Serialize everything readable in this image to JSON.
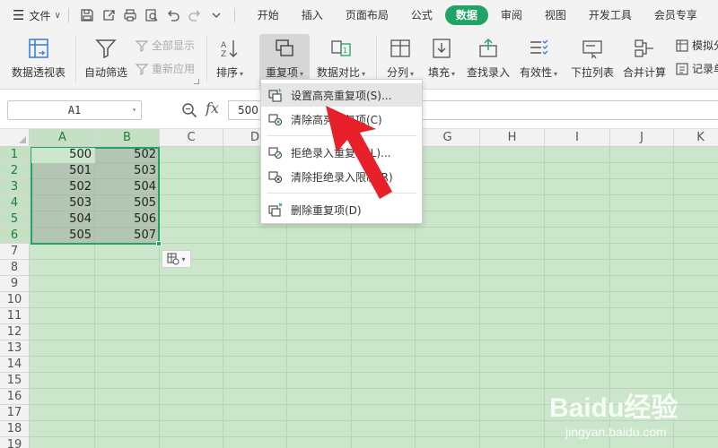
{
  "menubar": {
    "file_label": "文件",
    "tabs": [
      {
        "label": "开始",
        "active": false
      },
      {
        "label": "插入",
        "active": false
      },
      {
        "label": "页面布局",
        "active": false
      },
      {
        "label": "公式",
        "active": false
      },
      {
        "label": "数据",
        "active": true
      },
      {
        "label": "审阅",
        "active": false
      },
      {
        "label": "视图",
        "active": false
      },
      {
        "label": "开发工具",
        "active": false
      },
      {
        "label": "会员专享",
        "active": false
      }
    ]
  },
  "ribbon": {
    "pivot": "数据透视表",
    "autofilter": "自动筛选",
    "show_all": "全部显示",
    "reapply": "重新应用",
    "sort": "排序",
    "duplicates": "重复项",
    "compare": "数据对比",
    "split": "分列",
    "fill": "填充",
    "lookup": "查找录入",
    "validity": "有效性",
    "dropdown_list": "下拉列表",
    "merge_calc": "合并计算",
    "simulate": "模拟分",
    "record": "记录单"
  },
  "formula_bar": {
    "name_box": "A1",
    "fx": "fx",
    "value": "500"
  },
  "grid": {
    "columns": [
      "A",
      "B",
      "C",
      "D",
      "E",
      "F",
      "G",
      "H",
      "I",
      "J",
      "K"
    ],
    "rows": [
      "1",
      "2",
      "3",
      "4",
      "5",
      "6",
      "7",
      "8",
      "9",
      "10",
      "11",
      "12",
      "13",
      "14",
      "15",
      "16",
      "17",
      "18",
      "19"
    ],
    "cells": [
      [
        "500",
        "502"
      ],
      [
        "501",
        "503"
      ],
      [
        "502",
        "504"
      ],
      [
        "503",
        "505"
      ],
      [
        "504",
        "506"
      ],
      [
        "505",
        "507"
      ]
    ]
  },
  "dropdown": {
    "items": [
      "设置高亮重复项(S)...",
      "清除高亮重复项(C)",
      "拒绝录入重复项(L)...",
      "清除拒绝录入限制(R)",
      "删除重复项(D)"
    ]
  },
  "watermark": {
    "logo": "Baidu经验",
    "url": "jingyan.baidu.com"
  },
  "colors": {
    "accent": "#21a366",
    "grid_bg": "#cbe6ca",
    "arrow": "#e8202a"
  }
}
